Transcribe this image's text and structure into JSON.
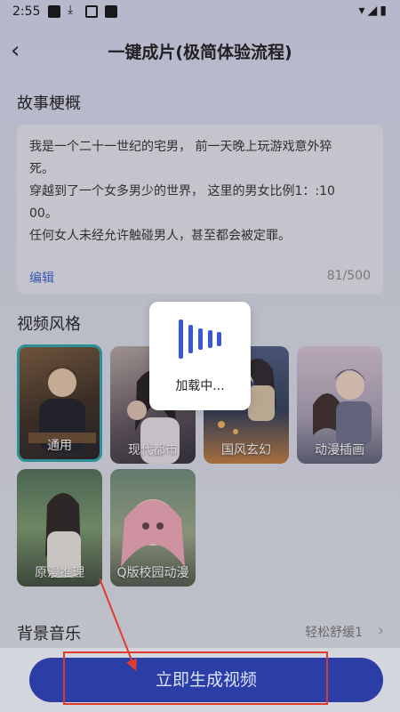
{
  "status_bar": {
    "time": "2:55"
  },
  "header": {
    "back_label": "‹",
    "title": "一键成片(极简体验流程)"
  },
  "story": {
    "section_title": "故事梗概",
    "lines": [
      "我是一个二十一世纪的宅男， 前一天晚上玩游戏意外猝",
      "死。",
      "穿越到了一个女多男少的世界， 这里的男女比例1：:10",
      "00。",
      " 任何女人未经允许触碰男人，甚至都会被定罪。"
    ],
    "edit_label": "编辑",
    "char_count": "81/500"
  },
  "video_style": {
    "section_title": "视频风格",
    "cards": [
      {
        "label": "通用",
        "selected": true
      },
      {
        "label": "现代都市",
        "selected": false
      },
      {
        "label": "国风玄幻",
        "selected": false
      },
      {
        "label": "动漫插画",
        "selected": false
      },
      {
        "label": "原漫推理",
        "selected": false
      },
      {
        "label": "Q版校园动漫",
        "selected": false
      }
    ]
  },
  "bg_music": {
    "section_title": "背景音乐",
    "value": "轻松舒缓1",
    "chevron": "›"
  },
  "generate_button": {
    "label": "立即生成视频"
  },
  "loading": {
    "text": "加载中..."
  },
  "colors": {
    "accent": "#2b3ea6",
    "selected_border": "#2aa5a8",
    "annotation": "#e23a2c",
    "link": "#3a5fcf"
  }
}
